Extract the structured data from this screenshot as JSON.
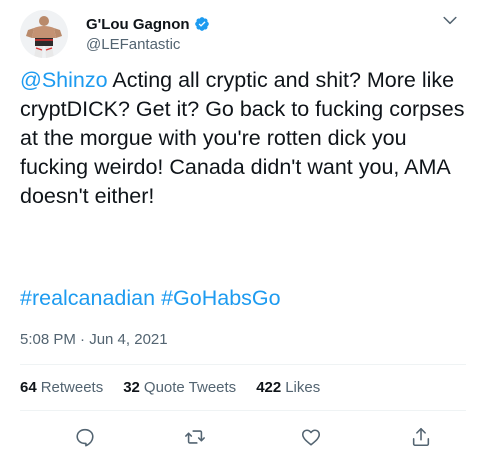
{
  "author": {
    "display_name": "G'Lou Gagnon",
    "handle": "@LEFantastic",
    "verified": true
  },
  "tweet": {
    "mention": "@Shinzo",
    "body": " Acting all cryptic and shit? More like cryptDICK? Get it? Go back to fucking corpses at the morgue with you're rotten dick you fucking weirdo! Canada didn't want you, AMA doesn't either!",
    "hashtag_1": "#realcanadian",
    "hashtag_2": "#GoHabsGo",
    "timestamp": "5:08 PM · Jun 4, 2021"
  },
  "stats": {
    "retweets_count": "64",
    "retweets_label": "Retweets",
    "quote_count": "32",
    "quote_label": "Quote Tweets",
    "likes_count": "422",
    "likes_label": "Likes"
  },
  "icons": {
    "verified": "verified-badge-icon",
    "more": "chevron-down-icon",
    "reply": "reply-icon",
    "retweet": "retweet-icon",
    "like": "heart-icon",
    "share": "share-icon"
  },
  "colors": {
    "accent": "#1d9bf0",
    "text": "#0f1419",
    "secondary": "#536471",
    "divider": "#eff3f4"
  }
}
